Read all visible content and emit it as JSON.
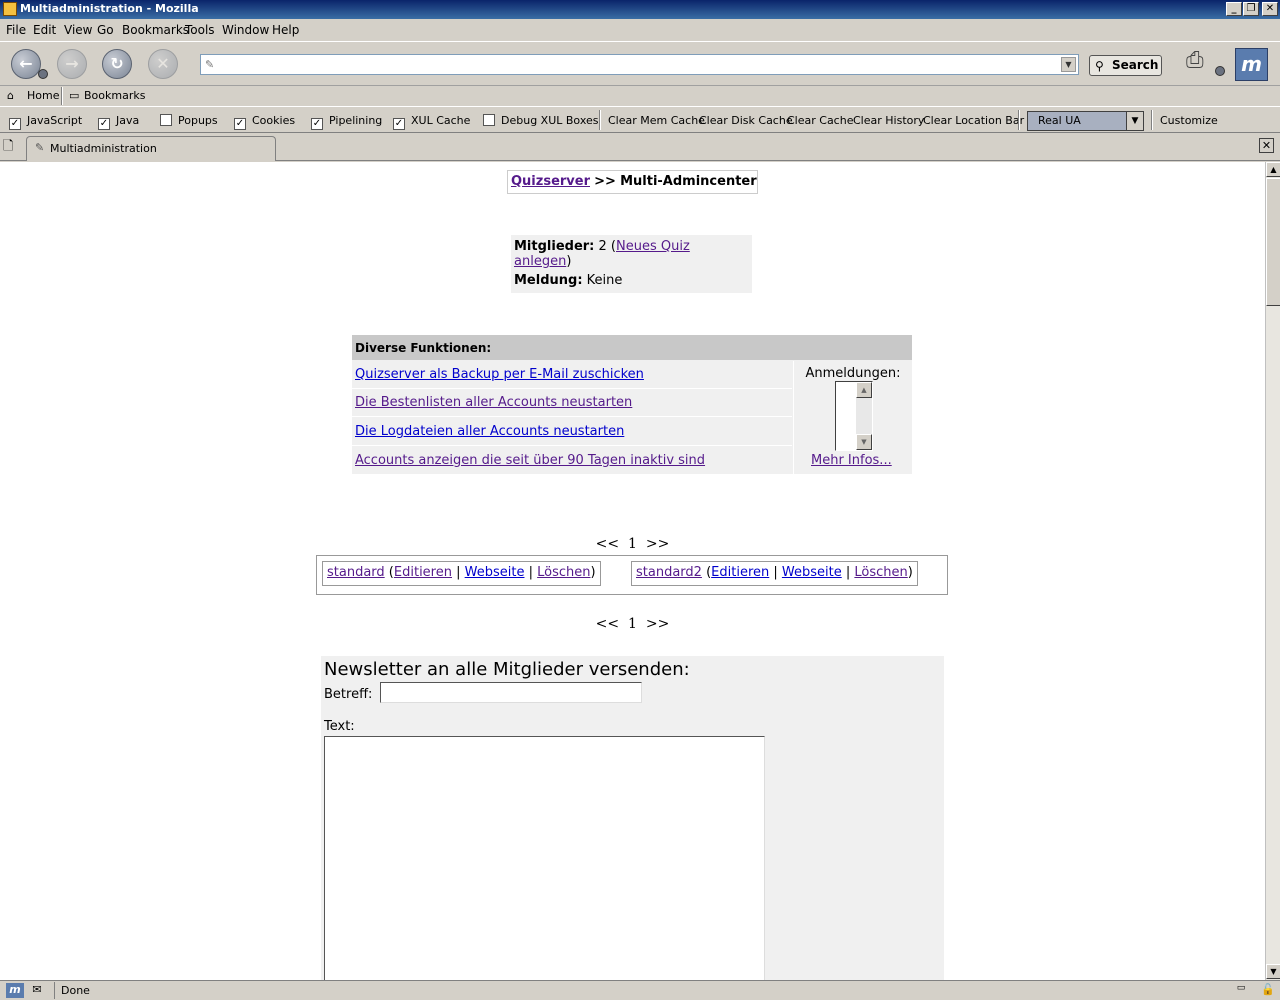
{
  "window": {
    "title": "Multiadministration - Mozilla",
    "controls": [
      "_",
      "❐",
      "✕"
    ]
  },
  "menu": [
    "File",
    "Edit",
    "View",
    "Go",
    "Bookmarks",
    "Tools",
    "Window",
    "Help"
  ],
  "navbar": {
    "url": "",
    "search_label": "Search"
  },
  "personal_toolbar": {
    "home": "Home",
    "bookmarks": "Bookmarks"
  },
  "prefbar": {
    "checkboxes": [
      {
        "label": "JavaScript",
        "checked": true
      },
      {
        "label": "Java",
        "checked": true
      },
      {
        "label": "Popups",
        "checked": false
      },
      {
        "label": "Cookies",
        "checked": true
      },
      {
        "label": "Pipelining",
        "checked": true
      },
      {
        "label": "XUL Cache",
        "checked": true
      },
      {
        "label": "Debug XUL Boxes",
        "checked": false
      }
    ],
    "buttons": [
      "Clear Mem Cache",
      "Clear Disk Cache",
      "Clear Cache",
      "Clear History",
      "Clear Location Bar"
    ],
    "ua_value": "Real UA",
    "customize": "Customize"
  },
  "tabs": [
    {
      "label": "Multiadministration"
    }
  ],
  "page": {
    "breadcrumb": {
      "link": "Quizserver",
      "separator": ">>",
      "current": "Multi-Admincenter"
    },
    "stats": {
      "members_label": "Mitglieder:",
      "members_value": "2",
      "new_quiz_link": "Neues Quiz anlegen",
      "message_label": "Meldung:",
      "message_value": "Keine"
    },
    "functions": {
      "header": "Diverse Funktionen:",
      "links": [
        "Quizserver als Backup per E-Mail zuschicken",
        "Die Bestenlisten aller Accounts neustarten",
        "Die Logdateien aller Accounts neustarten",
        "Accounts anzeigen die seit über 90 Tagen inaktiv sind"
      ],
      "signups_label": "Anmeldungen:",
      "more_info": "Mehr Infos..."
    },
    "pager": {
      "prev": "<<",
      "page": "1",
      "next": ">>"
    },
    "accounts": [
      {
        "name": "standard",
        "edit": "Editieren",
        "website": "Webseite",
        "delete": "Löschen"
      },
      {
        "name": "standard2",
        "edit": "Editieren",
        "website": "Webseite",
        "delete": "Löschen"
      }
    ],
    "newsletter": {
      "title": "Newsletter an alle Mitglieder versenden:",
      "subject_label": "Betreff:",
      "subject_value": "",
      "text_label": "Text:",
      "text_value": ""
    }
  },
  "status": {
    "text": "Done"
  }
}
